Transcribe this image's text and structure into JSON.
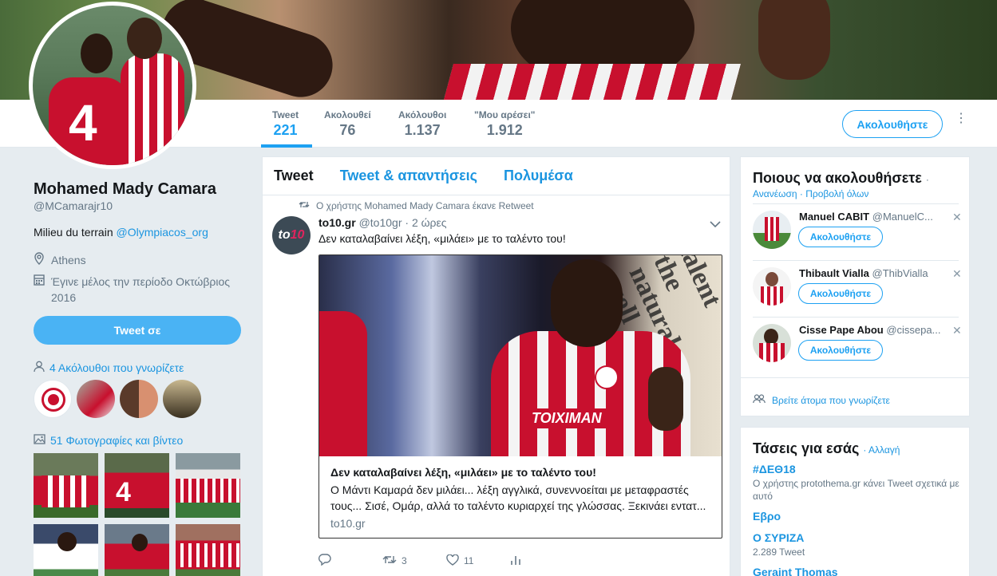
{
  "profile": {
    "name": "Mohamed Mady Camara",
    "handle": "@MCamarajr10",
    "bio_text": "Milieu du terrain",
    "bio_link": "@Olympiacos_org",
    "location": "Athens",
    "joined": "Έγινε μέλος την περίοδο Οκτώβριος 2016",
    "tweet_to_label": "Tweet σε",
    "mutual_followers": "4 Ακόλουθοι που γνωρίζετε",
    "media_count": "51 Φωτογραφίες και βίντεο"
  },
  "nav": {
    "stats": [
      {
        "label": "Tweet",
        "value": "221"
      },
      {
        "label": "Ακολουθεί",
        "value": "76"
      },
      {
        "label": "Ακόλουθοι",
        "value": "1.137"
      },
      {
        "label": "\"Μου αρέσει\"",
        "value": "1.912"
      }
    ],
    "follow_label": "Ακολουθήστε",
    "more_icon": "⋮"
  },
  "timeline": {
    "tabs": [
      "Tweet",
      "Tweet & απαντήσεις",
      "Πολυμέσα"
    ],
    "retweet_line": "Ο χρήστης Mohamed Mady Camara έκανε Retweet",
    "tweet": {
      "author_name": "to10.gr",
      "author_handle": "@to10gr",
      "time": "· 2 ώρες",
      "text": "Δεν καταλαβαίνει λέξη, «μιλάει» με το ταλέντο του!",
      "card": {
        "title": "Δεν καταλαβαίνει λέξη, «μιλάει» με το ταλέντο του!",
        "description": "Ο Μάντι Καμαρά δεν μιλάει... λέξη αγγλικά, συνεννοείται με μεταφραστές τους... Σισέ, Ομάρ, αλλά το ταλέντο κυριαρχεί της γλώσσας. Ξεκινάει εντατ...",
        "domain": "to10.gr",
        "image_sponsor": "TOIXIMAN",
        "image_text": "talent the natural well"
      },
      "actions": {
        "reply": "",
        "retweets": "3",
        "likes": "11",
        "analytics": ""
      }
    }
  },
  "who_to_follow": {
    "title": "Ποιους να ακολουθήσετε",
    "refresh": "Ανανέωση",
    "view_all": "Προβολή όλων",
    "follow_label": "Ακολουθήστε",
    "users": [
      {
        "name": "Manuel CABIT",
        "handle": "@ManuelC..."
      },
      {
        "name": "Thibault Vialla",
        "handle": "@ThibVialla"
      },
      {
        "name": "Cisse Pape Abou",
        "handle": "@cissepa..."
      }
    ],
    "find_people": "Βρείτε άτομα που γνωρίζετε"
  },
  "trends": {
    "title": "Τάσεις για εσάς",
    "change": "Αλλαγή",
    "items": [
      {
        "name": "#ΔΕΘ18",
        "context": "Ο χρήστης protothema.gr κάνει Tweet σχετικά με αυτό"
      },
      {
        "name": "Εβρο",
        "context": ""
      },
      {
        "name": "Ο ΣΥΡΙΖΑ",
        "context": "2.289 Tweet"
      },
      {
        "name": "Geraint Thomas",
        "context": ""
      }
    ]
  },
  "colors": {
    "accent": "#1da1f2",
    "link": "#1b95e0",
    "olympiacos_red": "#c8102e"
  }
}
